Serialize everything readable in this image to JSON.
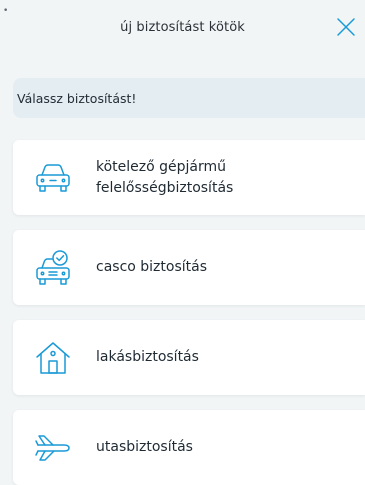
{
  "status": {
    "dot": "•"
  },
  "header": {
    "title": "új biztosítást kötök",
    "close_icon": "close-icon"
  },
  "prompt": {
    "text": "Válassz biztosítást!"
  },
  "cards": [
    {
      "name": "mtpl",
      "icon": "car-icon",
      "label_lines": [
        "kötelező gépjármű",
        "felelősségbiztosítás"
      ]
    },
    {
      "name": "casco",
      "icon": "car-check-icon",
      "label_lines": [
        "casco biztosítás"
      ]
    },
    {
      "name": "home",
      "icon": "house-icon",
      "label_lines": [
        "lakásbiztosítás"
      ]
    },
    {
      "name": "travel",
      "icon": "airplane-icon",
      "label_lines": [
        "utasbiztosítás"
      ]
    }
  ],
  "colors": {
    "accent": "#1a9ad6",
    "background": "#f2f5f6",
    "prompt_bg": "#e4edf1",
    "card_bg": "#ffffff",
    "text": "#1f2a33"
  }
}
